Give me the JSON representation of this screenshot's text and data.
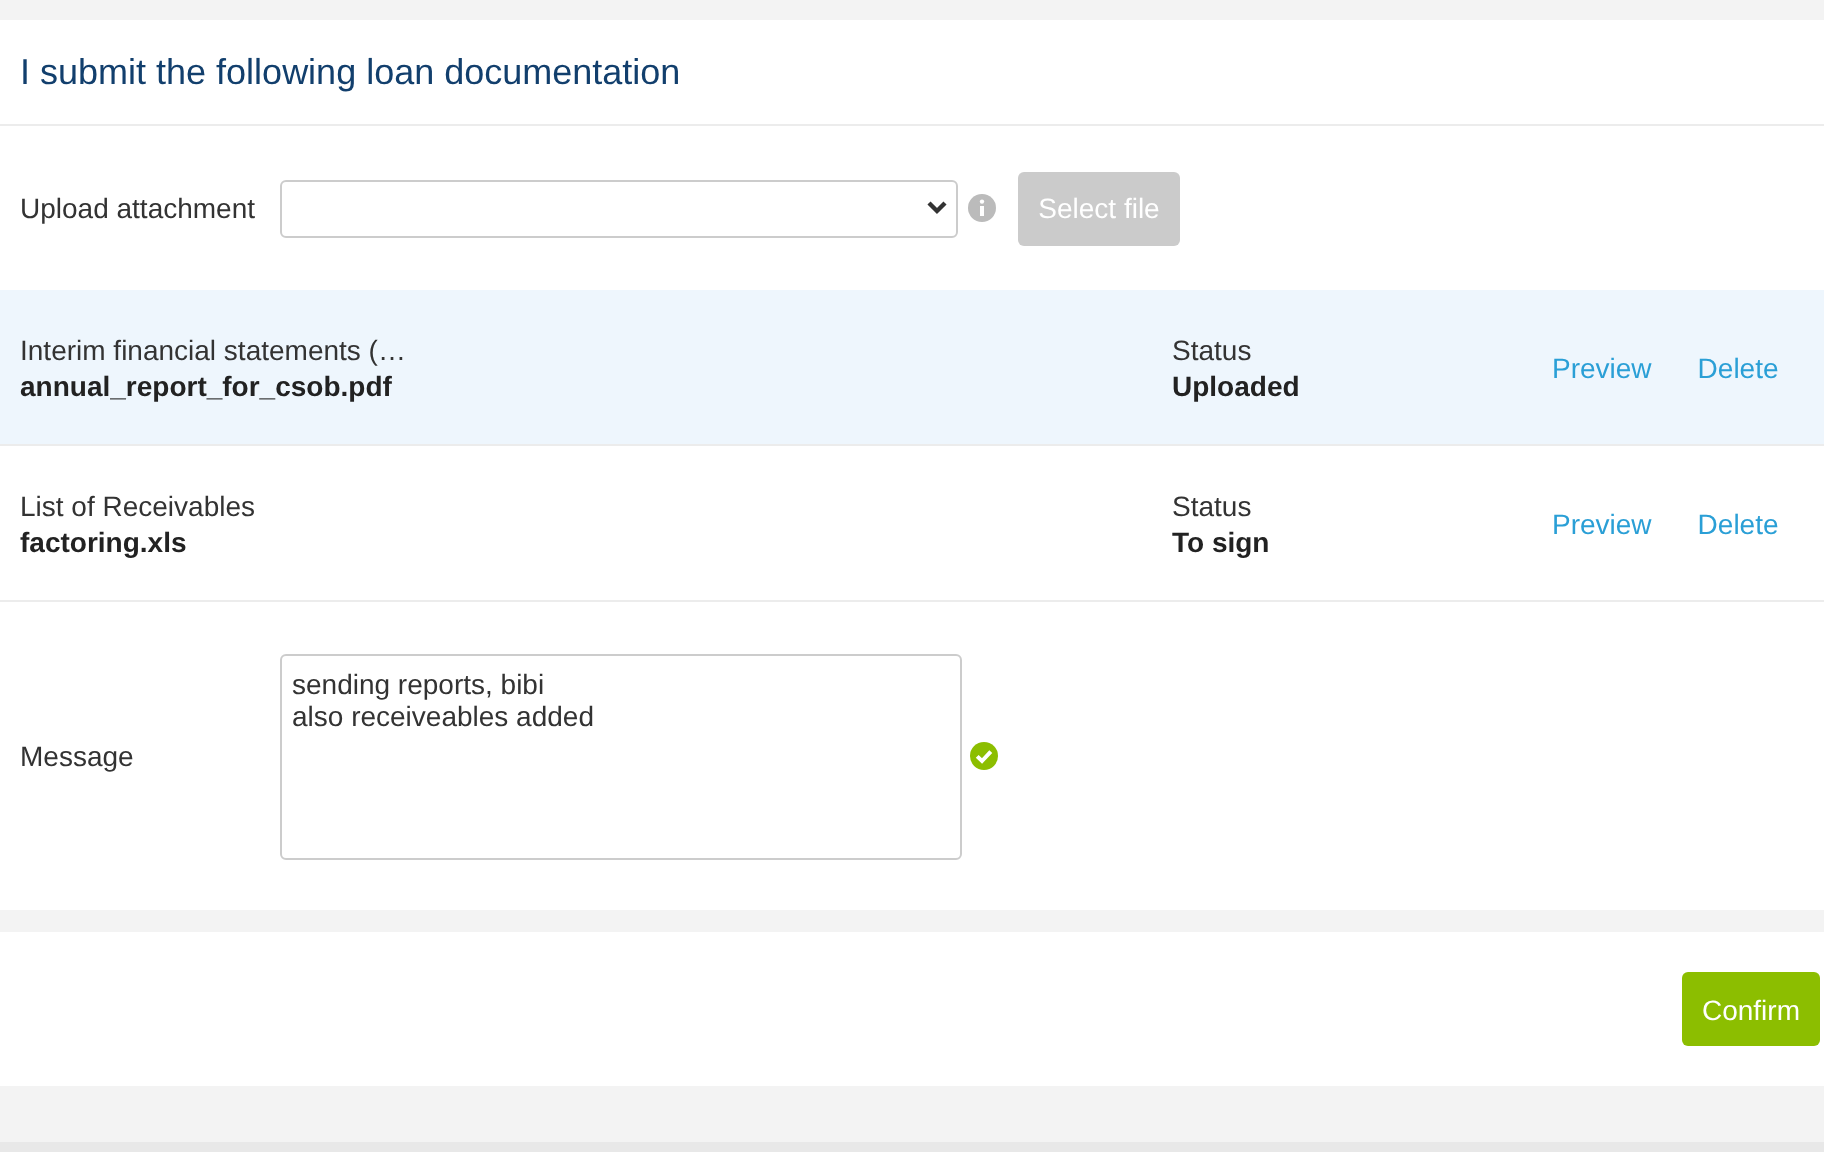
{
  "title": "I submit the following loan documentation",
  "upload": {
    "label": "Upload attachment",
    "select_file": {
      "label": "Select file",
      "disabled": true
    }
  },
  "documents": [
    {
      "name": "Interim financial statements (…",
      "file": "annual_report_for_csob.pdf",
      "status_label": "Status",
      "status": "Uploaded",
      "selected": true,
      "actions": [
        "Preview",
        "Delete"
      ]
    },
    {
      "name": "List of Receivables",
      "file": "factoring.xls",
      "status_label": "Status",
      "status": "To sign",
      "selected": false,
      "actions": [
        "Preview",
        "Delete"
      ]
    }
  ],
  "message": {
    "label": "Message",
    "value": "sending reports, bibi\nalso receiveables added",
    "valid": true
  },
  "confirm": "Confirm"
}
